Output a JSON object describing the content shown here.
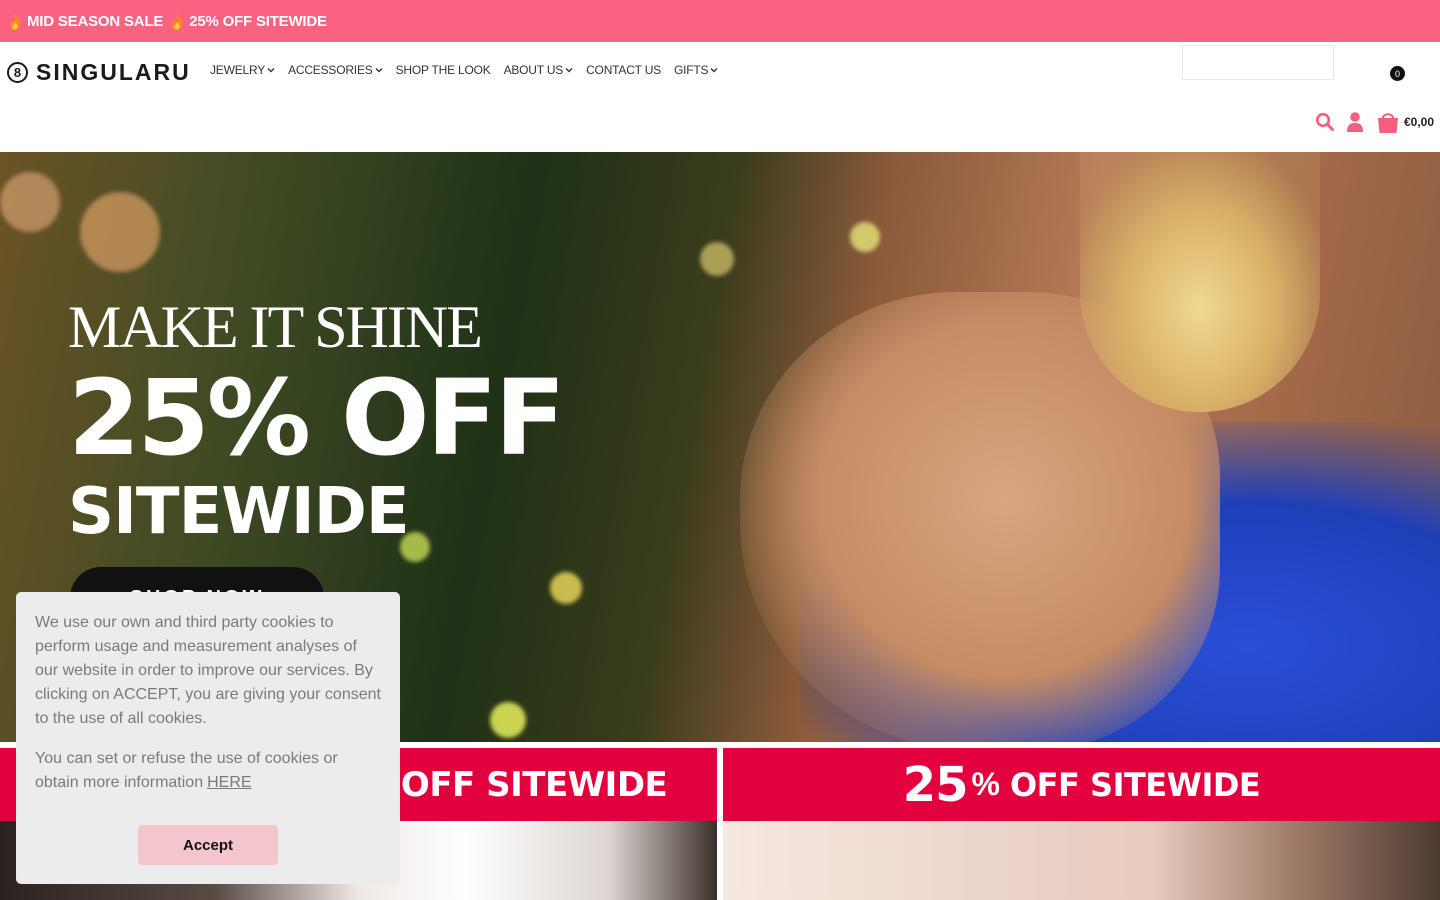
{
  "announcement": {
    "text_1": "MID SEASON SALE",
    "text_2": "25% OFF SITEWIDE",
    "icon": "flame-icon",
    "background": "#fb6281"
  },
  "header": {
    "logo_mark": "8",
    "logo_text": "SINGULARU",
    "nav": [
      {
        "label": "JEWELRY",
        "has_dropdown": true
      },
      {
        "label": "ACCESSORIES",
        "has_dropdown": true
      },
      {
        "label": "SHOP THE LOOK",
        "has_dropdown": false
      },
      {
        "label": "ABOUT US",
        "has_dropdown": true
      },
      {
        "label": "CONTACT US",
        "has_dropdown": false
      },
      {
        "label": "GIFTS",
        "has_dropdown": true
      }
    ],
    "search_placeholder": "",
    "cart_count": "0",
    "cart_total": "€0,00",
    "accent": "#f25f80"
  },
  "hero": {
    "line_1": "MAKE IT SHINE",
    "line_2": "25% OFF",
    "line_3": "SITEWIDE",
    "cta": "SHOP NOW"
  },
  "promos": {
    "left_text": "25% OFF SITEWIDE",
    "right_big": "25",
    "right_pct": "%",
    "right_rest": "OFF SITEWIDE",
    "strip_color": "#e3003e"
  },
  "cookie": {
    "paragraph_1": "We use our own and third party cookies to perform usage and measurement analyses of our website in order to improve our services. By clicking on ACCEPT, you are giving your consent to the use of all cookies.",
    "paragraph_2": "You can set or refuse the use of cookies or obtain more information",
    "link": "HERE",
    "accept": "Accept"
  }
}
